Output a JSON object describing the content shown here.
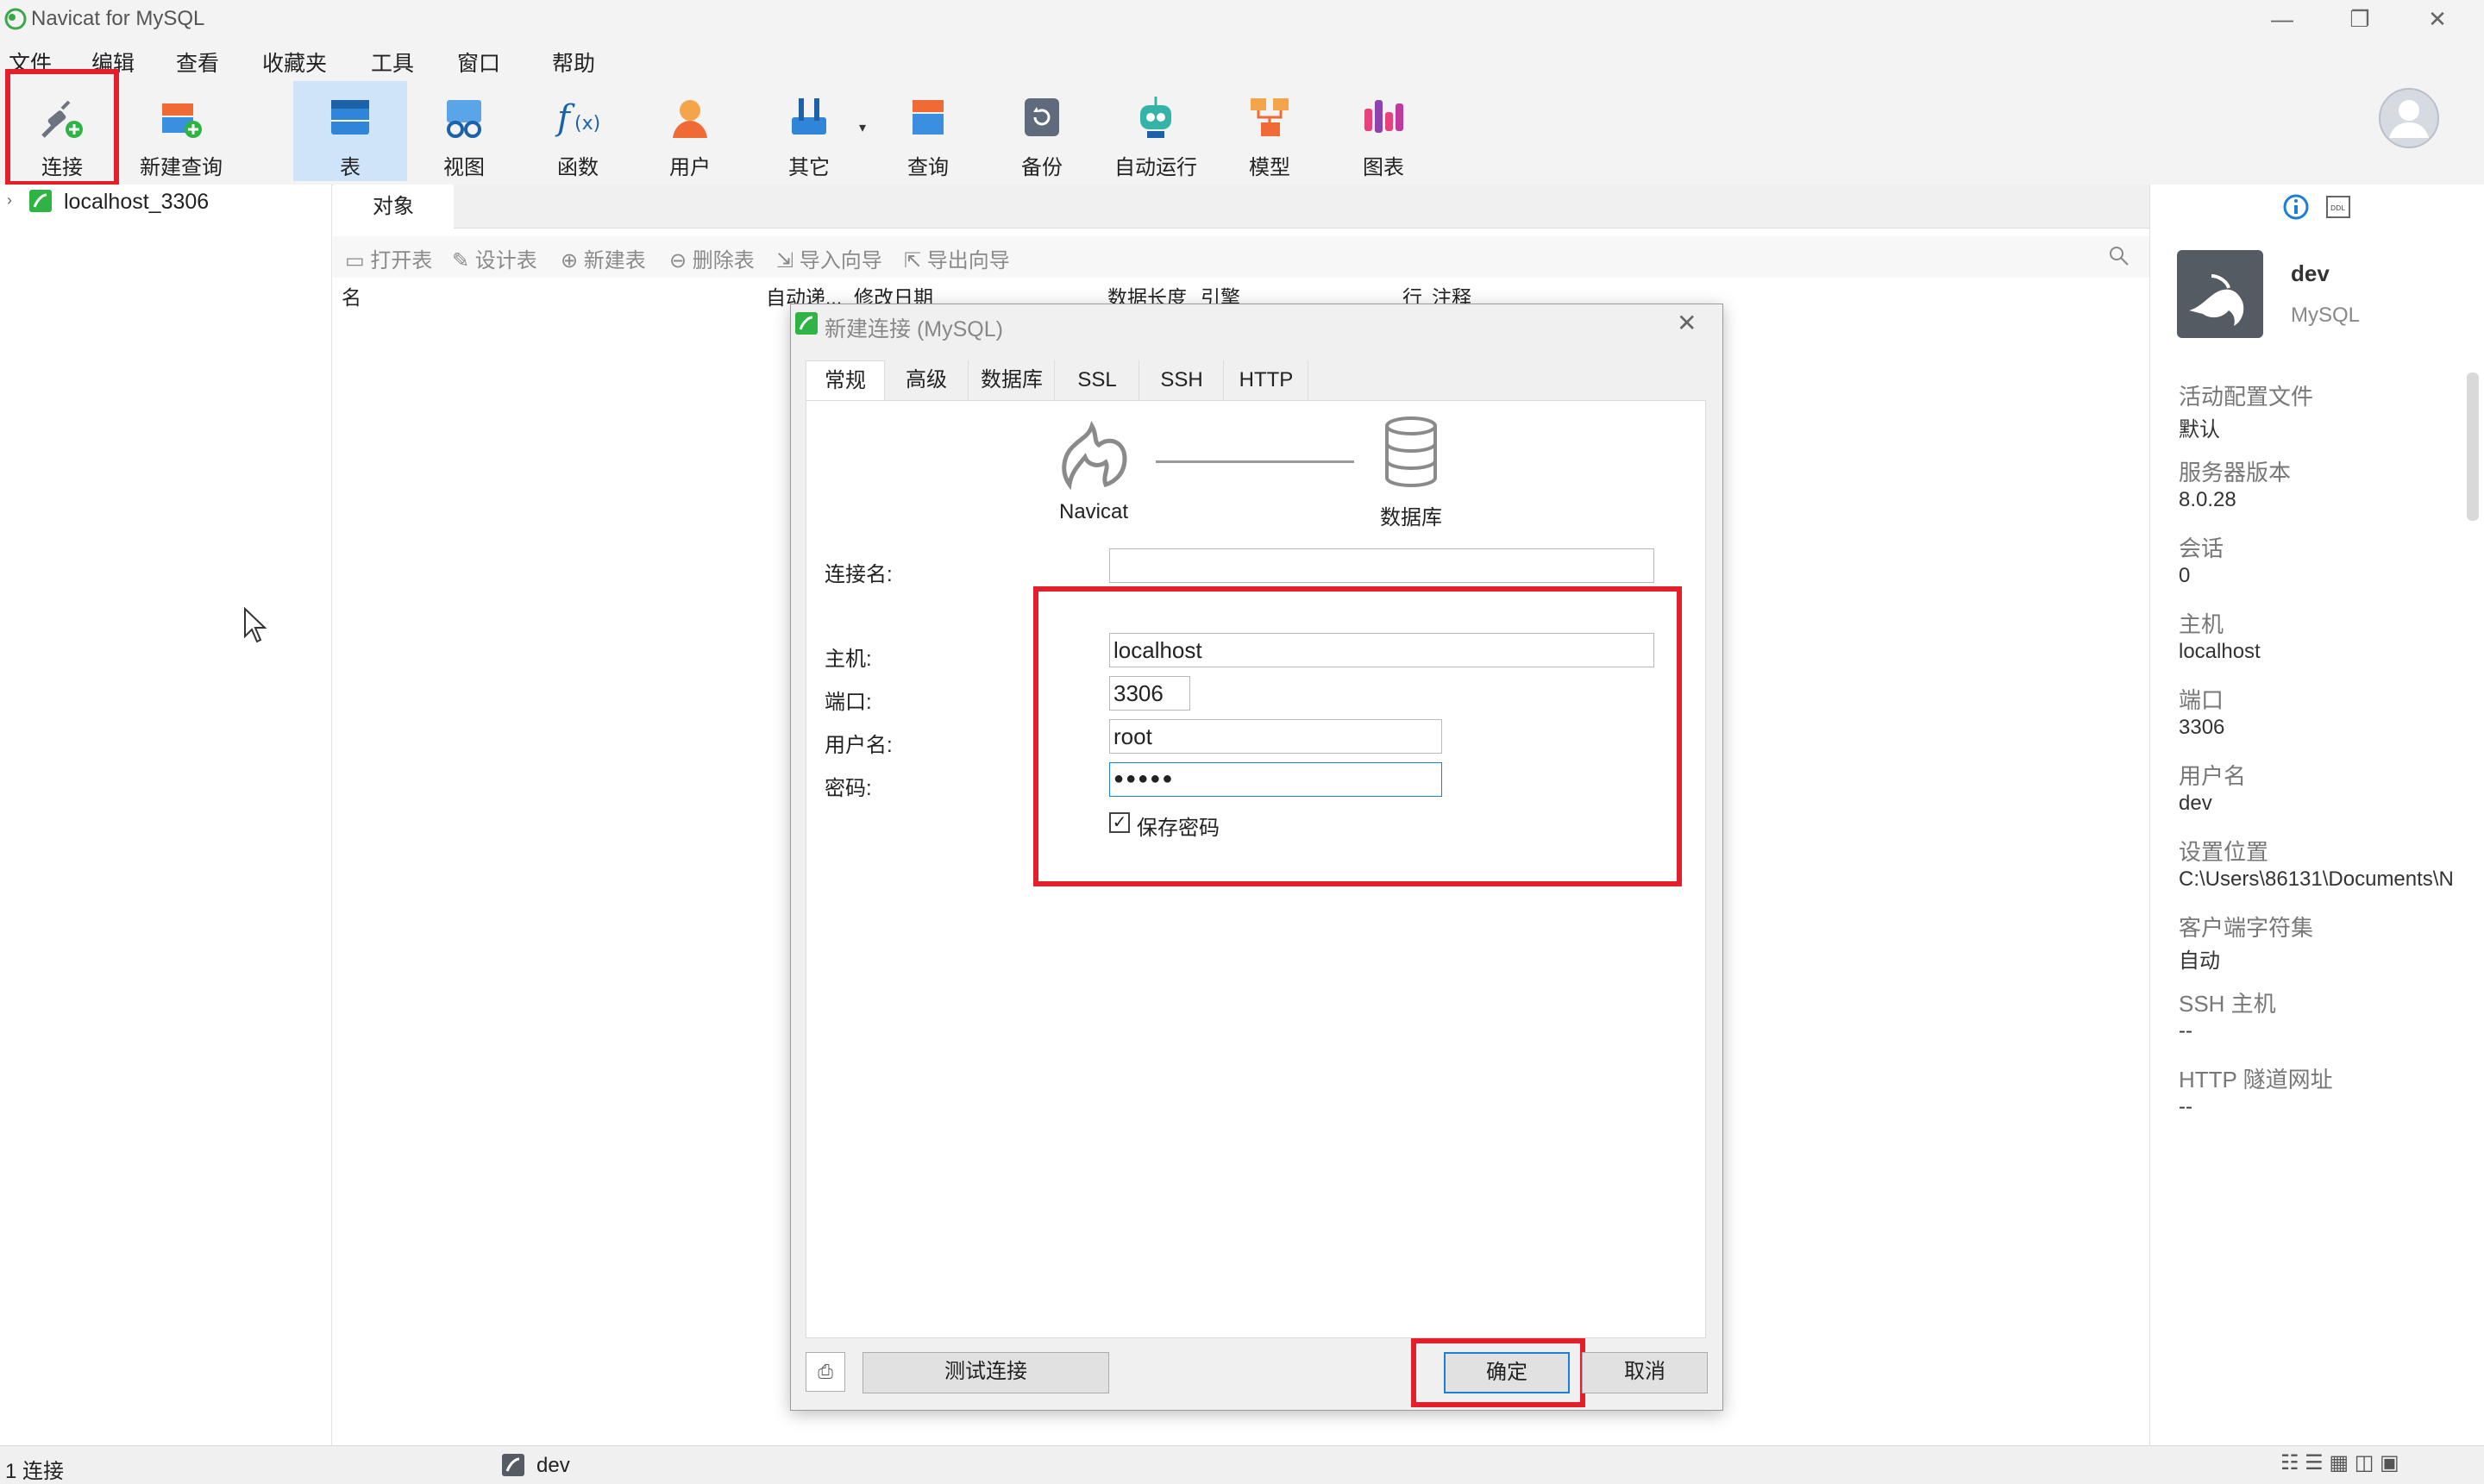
{
  "window": {
    "title": "Navicat for MySQL"
  },
  "menu": [
    "文件",
    "编辑",
    "查看",
    "收藏夹",
    "工具",
    "窗口",
    "帮助"
  ],
  "toolbar": [
    {
      "label": "连接",
      "icon": "plug-icon"
    },
    {
      "label": "新建查询",
      "icon": "new-query-icon"
    },
    {
      "label": "表",
      "icon": "table-icon"
    },
    {
      "label": "视图",
      "icon": "view-icon"
    },
    {
      "label": "函数",
      "icon": "function-icon"
    },
    {
      "label": "用户",
      "icon": "user-icon"
    },
    {
      "label": "其它",
      "icon": "tools-icon"
    },
    {
      "label": "查询",
      "icon": "query-icon"
    },
    {
      "label": "备份",
      "icon": "backup-icon"
    },
    {
      "label": "自动运行",
      "icon": "robot-icon"
    },
    {
      "label": "模型",
      "icon": "model-icon"
    },
    {
      "label": "图表",
      "icon": "chart-icon"
    }
  ],
  "tree": {
    "connection": "localhost_3306"
  },
  "objects": {
    "tab": "对象",
    "actions": [
      "打开表",
      "设计表",
      "新建表",
      "删除表",
      "导入向导",
      "导出向导"
    ],
    "columns": [
      "名",
      "自动递...",
      "修改日期",
      "数据长度",
      "引擎",
      "行",
      "注释"
    ]
  },
  "dialog": {
    "title": "新建连接 (MySQL)",
    "tabs": [
      "常规",
      "高级",
      "数据库",
      "SSL",
      "SSH",
      "HTTP"
    ],
    "navicat_label": "Navicat",
    "db_label": "数据库",
    "labels": {
      "conn_name": "连接名:",
      "host": "主机:",
      "port": "端口:",
      "user": "用户名:",
      "password": "密码:"
    },
    "values": {
      "conn_name": "",
      "host": "localhost",
      "port": "3306",
      "user": "root",
      "password": "●●●●●"
    },
    "save_password": "保存密码",
    "buttons": {
      "test": "测试连接",
      "ok": "确定",
      "cancel": "取消"
    }
  },
  "info": {
    "name": "dev",
    "type": "MySQL",
    "fields": [
      {
        "key": "活动配置文件",
        "value": "默认"
      },
      {
        "key": "服务器版本",
        "value": "8.0.28"
      },
      {
        "key": "会话",
        "value": "0"
      },
      {
        "key": "主机",
        "value": "localhost"
      },
      {
        "key": "端口",
        "value": "3306"
      },
      {
        "key": "用户名",
        "value": "dev"
      },
      {
        "key": "设置位置",
        "value": "C:\\Users\\86131\\Documents\\N"
      },
      {
        "key": "客户端字符集",
        "value": "自动"
      },
      {
        "key": "SSH 主机",
        "value": "--"
      },
      {
        "key": "HTTP 隧道网址",
        "value": "--"
      }
    ]
  },
  "status": {
    "left": "1 连接",
    "conn": "dev"
  }
}
